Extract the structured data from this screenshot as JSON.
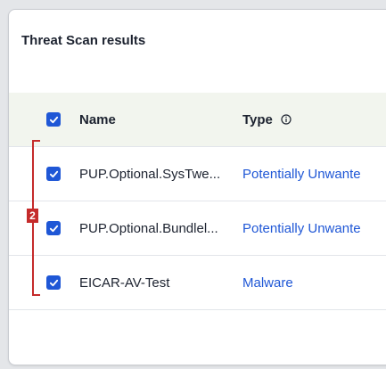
{
  "title": "Threat Scan results",
  "columns": {
    "name": "Name",
    "type": "Type",
    "type_info_icon": "info-icon"
  },
  "rows": [
    {
      "name": "PUP.Optional.SysTwe...",
      "type": "Potentially Unwante",
      "checked": true
    },
    {
      "name": "PUP.Optional.Bundlel...",
      "type": "Potentially Unwante",
      "checked": true
    },
    {
      "name": "EICAR-AV-Test",
      "type": "Malware",
      "checked": true
    }
  ],
  "annotation": {
    "label": "2",
    "color": "#c52b2b"
  },
  "colors": {
    "accent": "#1f57d6",
    "header_bg": "#f2f5ee"
  }
}
